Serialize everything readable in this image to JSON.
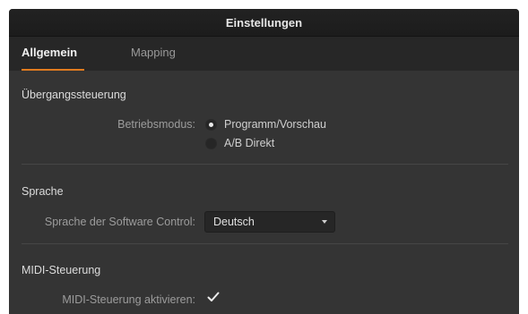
{
  "window": {
    "title": "Einstellungen"
  },
  "tabs": [
    {
      "label": "Allgemein",
      "active": true
    },
    {
      "label": "Mapping",
      "active": false
    }
  ],
  "transition": {
    "section_title": "Übergangssteuerung",
    "mode_label": "Betriebsmodus:",
    "options": [
      {
        "label": "Programm/Vorschau",
        "selected": true
      },
      {
        "label": "A/B Direkt",
        "selected": false
      }
    ]
  },
  "language": {
    "section_title": "Sprache",
    "label": "Sprache der Software Control:",
    "selected_value": "Deutsch"
  },
  "midi": {
    "section_title": "MIDI-Steuerung",
    "enable_label": "MIDI-Steuerung aktivieren:",
    "enabled": true
  },
  "colors": {
    "accent": "#e07b1f",
    "window_bg": "#343434",
    "titlebar_bg": "#1e1e1e"
  }
}
